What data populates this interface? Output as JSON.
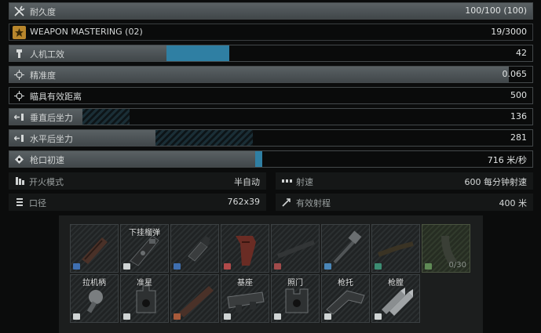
{
  "stats": [
    {
      "icon": "wrench-screwdriver-icon",
      "label": "耐久度",
      "value": "100/100 (100)",
      "fill_pct": 100,
      "ext_pct": 0,
      "ext": "none"
    },
    {
      "icon": "mastery-badge-icon",
      "label": "WEAPON MASTERING (02)",
      "value": "19/3000",
      "fill_pct": 0,
      "ext_pct": 0,
      "ext": "none"
    },
    {
      "icon": "ergonomics-icon",
      "label": "人机工效",
      "value": "42",
      "fill_pct": 30,
      "ext_pct": 12,
      "ext": "blue"
    },
    {
      "icon": "crosshair-icon",
      "label": "精准度",
      "value": "0.065",
      "fill_pct": 95.5,
      "ext_pct": 0,
      "ext": "none"
    },
    {
      "icon": "crosshair-icon",
      "label": "瞄具有效距离",
      "value": "500",
      "fill_pct": 0,
      "ext_pct": 0,
      "ext": "none"
    },
    {
      "icon": "recoil-icon",
      "label": "垂直后坐力",
      "value": "136",
      "fill_pct": 14,
      "ext_pct": 9,
      "ext": "hatch"
    },
    {
      "icon": "recoil-icon",
      "label": "水平后坐力",
      "value": "281",
      "fill_pct": 28,
      "ext_pct": 18.5,
      "ext": "hatch"
    },
    {
      "icon": "muzzle-velocity-icon",
      "label": "枪口初速",
      "value": "716 米/秒",
      "fill_pct": 47,
      "ext_pct": 1.3,
      "ext": "blue"
    }
  ],
  "info": [
    {
      "icon": "fire-mode-icon",
      "label": "开火模式",
      "value": "半自动"
    },
    {
      "icon": "rate-of-fire-icon",
      "label": "射速",
      "value": "600 每分钟射速"
    },
    {
      "icon": "caliber-icon",
      "label": "口径",
      "value": "762x39"
    },
    {
      "icon": "range-icon",
      "label": "有效射程",
      "value": "400 米"
    }
  ],
  "slots_row1": [
    {
      "title": "",
      "tag_color": "#3f6fb0",
      "icon": "handguard-icon"
    },
    {
      "title": "下挂榴弹",
      "tag_color": "#cfd4d4",
      "icon": "underbarrel-launcher-icon"
    },
    {
      "title": "",
      "tag_color": "#3f6fb0",
      "icon": "gas-block-icon"
    },
    {
      "title": "",
      "tag_color": "#b04a4a",
      "icon": "pistol-grip-icon"
    },
    {
      "title": "",
      "tag_color": "#a14b4b",
      "icon": "handguard-icon"
    },
    {
      "title": "",
      "tag_color": "#4a86b8",
      "icon": "muzzle-device-icon"
    },
    {
      "title": "",
      "tag_color": "#3c8c72",
      "icon": "barrel-icon"
    },
    {
      "title": "",
      "tag_color": "#5f8a55",
      "icon": "magazine-icon",
      "count": "0/30"
    }
  ],
  "slots_row2": [
    {
      "title": "拉机柄",
      "tag_color": "#cfd4d4",
      "icon": "charging-handle-icon"
    },
    {
      "title": "准星",
      "tag_color": "#cfd4d4",
      "icon": "front-sight-icon"
    },
    {
      "title": "",
      "tag_color": "#a85a3a",
      "icon": "handguard-icon"
    },
    {
      "title": "基座",
      "tag_color": "#cfd4d4",
      "icon": "mount-icon"
    },
    {
      "title": "照门",
      "tag_color": "#cfd4d4",
      "icon": "rear-sight-icon"
    },
    {
      "title": "枪托",
      "tag_color": "#cfd4d4",
      "icon": "stock-icon"
    },
    {
      "title": "枪膛",
      "tag_color": "#cfd4d4",
      "icon": "chamber-rounds-icon"
    }
  ],
  "colors": {
    "accent_blue": "#2f7fa3",
    "panel_bg": "#1c1e1e",
    "row_border": "#44494b"
  }
}
